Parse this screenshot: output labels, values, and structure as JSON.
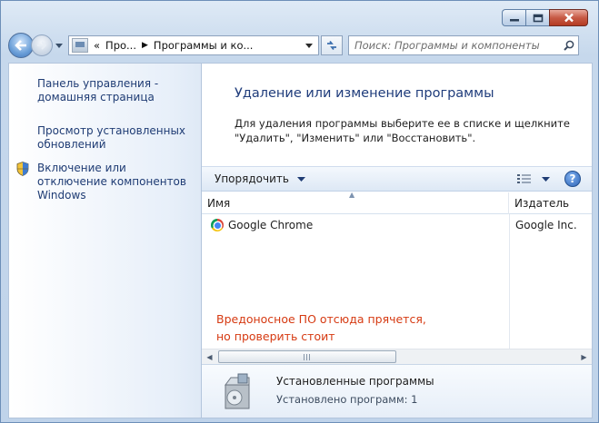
{
  "window": {
    "caption_buttons": [
      "minimize",
      "maximize",
      "close"
    ]
  },
  "nav": {
    "breadcrumbs": [
      "«",
      "Про...",
      "Программы и ко..."
    ],
    "search_placeholder": "Поиск: Программы и компоненты"
  },
  "sidebar": {
    "tasks": [
      {
        "label": "Панель управления - домашняя страница",
        "icon": null
      },
      {
        "label": "Просмотр установленных обновлений",
        "icon": null
      },
      {
        "label": "Включение или отключение компонентов Windows",
        "icon": "shield-icon"
      }
    ]
  },
  "main": {
    "title": "Удаление или изменение программы",
    "description": "Для удаления программы выберите ее в списке и щелкните \"Удалить\", \"Изменить\" или \"Восстановить\".",
    "toolbar": {
      "organize_label": "Упорядочить",
      "help_label": "?"
    },
    "columns": [
      "Имя",
      "Издатель"
    ],
    "rows": [
      {
        "name": "Google Chrome",
        "publisher": "Google Inc.",
        "icon": "chrome-icon"
      }
    ],
    "annotation": [
      "Вредоносное ПО отсюда прячется,",
      "но проверить стоит"
    ],
    "annotation_color": "#d63a12"
  },
  "details": {
    "title": "Установленные программы",
    "subtitle": "Установлено программ: 1"
  }
}
